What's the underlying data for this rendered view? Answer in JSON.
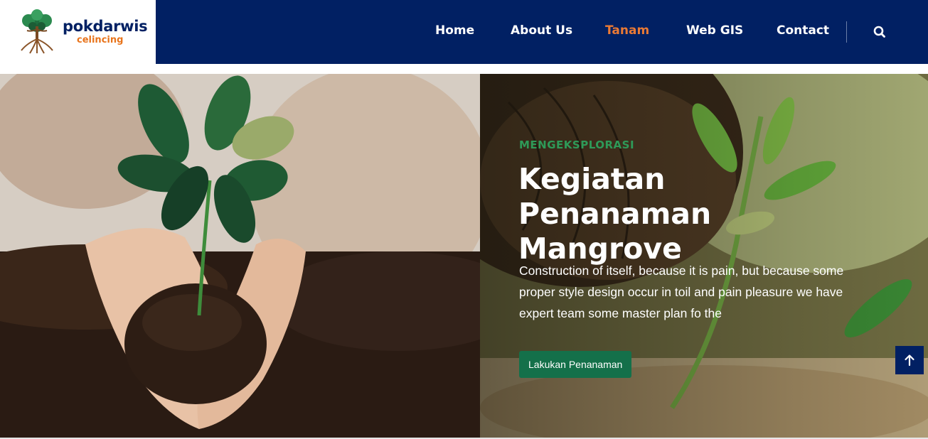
{
  "brand": {
    "name": "pokdarwis",
    "subname": "celincing",
    "colors": {
      "navy": "#012063",
      "orange": "#e8741c",
      "green": "#14704a"
    }
  },
  "nav": {
    "items": [
      {
        "label": "Home",
        "active": false
      },
      {
        "label": "About Us",
        "active": false
      },
      {
        "label": "Tanam",
        "active": true
      },
      {
        "label": "Web GIS",
        "active": false
      },
      {
        "label": "Contact",
        "active": false
      }
    ],
    "search_icon": "search-icon"
  },
  "hero": {
    "eyebrow": "MENGEKSPLORASI",
    "title": "Kegiatan Penanaman Mangrove",
    "description": "Construction of itself, because it is pain, but because some proper style design occur in toil and pain pleasure we have expert team some master plan fo the",
    "cta_label": "Lakukan Penanaman"
  },
  "scroll_top_icon": "arrow-up-icon"
}
